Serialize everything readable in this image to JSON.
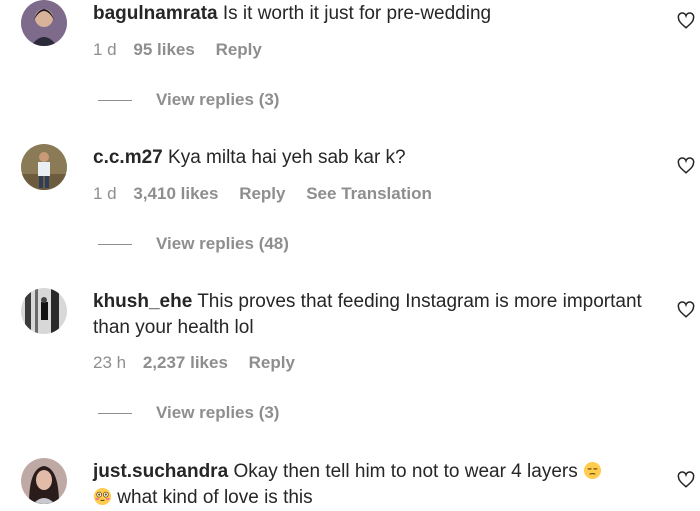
{
  "comments": [
    {
      "username": "bagulnamrata",
      "text": "Is it worth it just for pre-wedding",
      "time": "1 d",
      "likes": "95 likes",
      "reply": "Reply",
      "translation": "",
      "view_replies": "View replies (3)"
    },
    {
      "username": "c.c.m27",
      "text": "Kya milta hai yeh sab kar k?",
      "time": "1 d",
      "likes": "3,410 likes",
      "reply": "Reply",
      "translation": "See Translation",
      "view_replies": "View replies (48)"
    },
    {
      "username": "khush_ehe",
      "text": "This proves that feeding Instagram is more important than your health lol",
      "time": "23 h",
      "likes": "2,237 likes",
      "reply": "Reply",
      "translation": "",
      "view_replies": "View replies (3)"
    },
    {
      "username": "just.suchandra",
      "text_part1": "Okay then tell him to not to wear 4 layers",
      "text_part2": "what kind of love is this",
      "emoji_1": "pensive-face-emoji",
      "emoji_2": "flushed-face-emoji"
    }
  ],
  "colors": {
    "text": "#262626",
    "secondary": "#8e8e8e"
  }
}
